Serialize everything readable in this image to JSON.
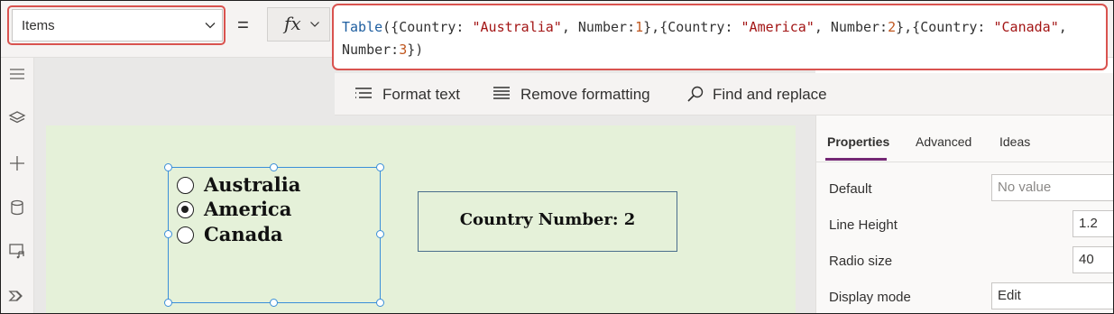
{
  "formula_bar": {
    "property_selector": {
      "value": "Items"
    },
    "equals_sign": "=",
    "fx_label": "fx",
    "formula_tokens": [
      {
        "t": "Table",
        "k": "fn"
      },
      {
        "t": "({Country: ",
        "k": "p"
      },
      {
        "t": "\"Australia\"",
        "k": "str"
      },
      {
        "t": ", Number:",
        "k": "p"
      },
      {
        "t": "1",
        "k": "num"
      },
      {
        "t": "},{Country: ",
        "k": "p"
      },
      {
        "t": "\"America\"",
        "k": "str"
      },
      {
        "t": ", Number:",
        "k": "p"
      },
      {
        "t": "2",
        "k": "num"
      },
      {
        "t": "},{Country: ",
        "k": "p"
      },
      {
        "t": "\"Canada\"",
        "k": "str"
      },
      {
        "t": ", Number:",
        "k": "p"
      },
      {
        "t": "3",
        "k": "num"
      },
      {
        "t": "})",
        "k": "p"
      }
    ]
  },
  "format_toolbar": {
    "format_text": "Format text",
    "remove_formatting": "Remove formatting",
    "find_replace": "Find and replace"
  },
  "left_rail": {
    "icons": [
      "menu-icon",
      "layers-icon",
      "add-icon",
      "data-icon",
      "media-icon",
      "power-automate-icon"
    ]
  },
  "canvas": {
    "radio": {
      "options": [
        {
          "label": "Australia",
          "selected": false
        },
        {
          "label": "America",
          "selected": true
        },
        {
          "label": "Canada",
          "selected": false
        }
      ]
    },
    "label_text": "Country Number: 2"
  },
  "properties_panel": {
    "tabs": [
      {
        "label": "Properties",
        "active": true
      },
      {
        "label": "Advanced",
        "active": false
      },
      {
        "label": "Ideas",
        "active": false
      }
    ],
    "rows": [
      {
        "label": "Default",
        "value": "",
        "placeholder": "No value"
      },
      {
        "label": "Line Height",
        "value": "1.2"
      },
      {
        "label": "Radio size",
        "value": "40"
      },
      {
        "label": "Display mode",
        "value": "Edit"
      }
    ]
  },
  "colors": {
    "highlight": "#d9534f",
    "selection": "#3b8fd9",
    "canvas_bg": "#e5f1d9",
    "accent_tab": "#742774"
  }
}
